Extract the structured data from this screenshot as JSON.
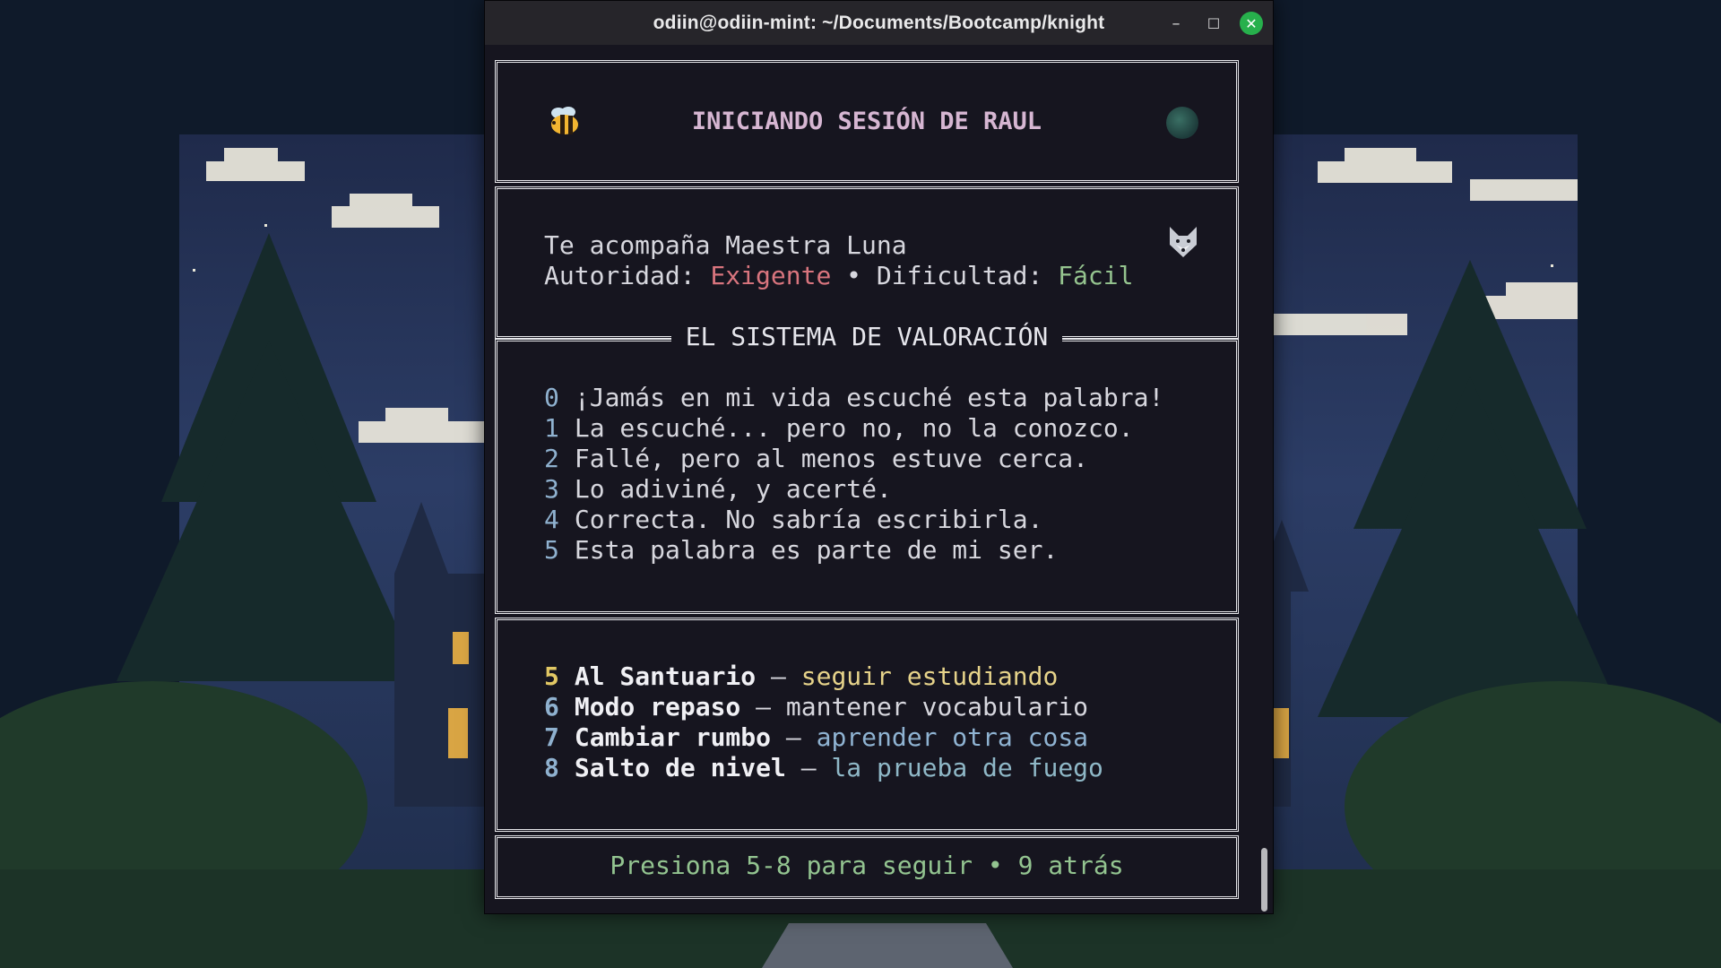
{
  "window": {
    "title": "odiin@odiin-mint: ~/Documents/Bootcamp/knight",
    "minimize_glyph": "–",
    "maximize_glyph": "☐",
    "close_glyph": "✕"
  },
  "header": {
    "title": "INICIANDO SESIÓN DE RAUL",
    "left_icon": "bee-icon",
    "right_icon": "moon-icon"
  },
  "companion": {
    "line1": "Te acompaña Maestra Luna",
    "authority_label": "Autoridad: ",
    "authority_value": "Exigente",
    "separator": " • ",
    "difficulty_label": "Dificultad: ",
    "difficulty_value": "Fácil",
    "icon": "wolf-icon"
  },
  "rating": {
    "title": "EL SISTEMA DE VALORACIÓN",
    "items": [
      {
        "num": "0",
        "text": "¡Jamás en mi vida escuché esta palabra!"
      },
      {
        "num": "1",
        "text": "La escuché... pero no, no la conozco."
      },
      {
        "num": "2",
        "text": "Fallé, pero al menos estuve cerca."
      },
      {
        "num": "3",
        "text": "Lo adiviné, y acerté."
      },
      {
        "num": "4",
        "text": "Correcta. No sabría escribirla."
      },
      {
        "num": "5",
        "text": "Esta palabra es parte de mi ser."
      }
    ]
  },
  "menu": {
    "dash": " – ",
    "items": [
      {
        "num": "5",
        "label": "Al Santuario",
        "desc": "seguir estudiando"
      },
      {
        "num": "6",
        "label": "Modo repaso",
        "desc": "mantener vocabulario"
      },
      {
        "num": "7",
        "label": "Cambiar rumbo",
        "desc": "aprender otra cosa"
      },
      {
        "num": "8",
        "label": "Salto de nivel",
        "desc": "la prueba de fuego"
      }
    ]
  },
  "footer": {
    "prompt": "Presiona 5-8 para seguir • 9 atrás"
  },
  "colors": {
    "terminal_bg": "#16151f",
    "title_pink": "#d6b6d2",
    "authority_red": "#d9757e",
    "difficulty_green": "#95c48f",
    "number_blue": "#8fb1cf",
    "number_yellow": "#e2c864",
    "desc_yellow": "#e6d38a",
    "desc_white": "#d7d7de",
    "desc_blue": "#8fb3d2",
    "desc_teal": "#8fb8c7",
    "close_green": "#27b04c"
  }
}
